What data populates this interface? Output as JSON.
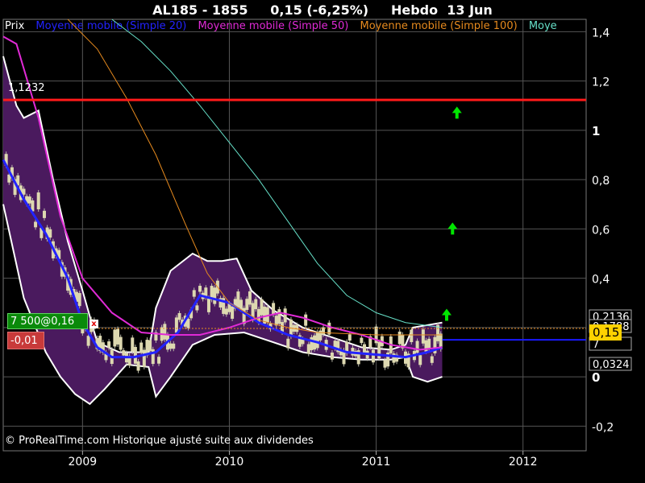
{
  "header": {
    "title": "AL185 - 1855     0,15 (-6,25%)     Hebdo  13 Jun"
  },
  "legend": [
    {
      "label": "Prix",
      "color": "#ffffff"
    },
    {
      "label": "Moyenne mobile (Simple 20)",
      "color": "#2323ff"
    },
    {
      "label": "Moyenne mobile (Simple 50)",
      "color": "#e02ad6"
    },
    {
      "label": "Moyenne mobile (Simple 100)",
      "color": "#e68a1e"
    },
    {
      "label": "Moye",
      "color": "#66e0c8"
    }
  ],
  "order": {
    "label": "7 500@0,16",
    "close_glyph": "x",
    "pnl": "-0,01"
  },
  "level_label": "1,1232",
  "copyright": "© ProRealTime.com Historique ajusté suite aux dividendes",
  "price_labels": {
    "hi": "0,2136",
    "last": "0,15",
    "mid": "0,1788",
    "low_partial": "7",
    "lo": "0,0324"
  },
  "colors": {
    "background": "#000000",
    "grid": "#555555",
    "band_fill": "#4a1a5e",
    "band_edge": "#ffffff",
    "sma20": "#2323ff",
    "sma50": "#e02ad6",
    "sma100": "#e68a1e",
    "sma200": "#66e0c8",
    "level": "#ff1a1a",
    "last_line": "#1a1aff",
    "arrow": "#00e600",
    "last_box": "#ffd200"
  },
  "chart_data": {
    "type": "line",
    "title": "AL185 - 1855     0,15 (-6,25%)     Hebdo  13 Jun",
    "xlabel": "",
    "ylabel": "",
    "x_ticks": [
      "2009",
      "2010",
      "2011",
      "2012"
    ],
    "x_tick_dates": [
      2009.0,
      2010.0,
      2011.0,
      2012.0
    ],
    "y_ticks": [
      "1,4",
      "1,2",
      "1",
      "0,8",
      "0,6",
      "0,4",
      "0,2",
      "0",
      "-0,2"
    ],
    "y_tick_values": [
      1.4,
      1.2,
      1.0,
      0.8,
      0.6,
      0.4,
      0.2,
      0.0,
      -0.2
    ],
    "ylim": [
      -0.3,
      1.45
    ],
    "xlim": [
      2008.46,
      2012.43
    ],
    "grid": true,
    "horizontal_level": 1.1232,
    "last_price": 0.15,
    "series": [
      {
        "name": "Moyenne mobile (Simple 20)",
        "x": [
          2008.46,
          2008.6,
          2008.75,
          2008.9,
          2009.0,
          2009.1,
          2009.2,
          2009.35,
          2009.5,
          2009.65,
          2009.8,
          2010.0,
          2010.2,
          2010.4,
          2010.6,
          2010.8,
          2011.0,
          2011.2,
          2011.35,
          2011.45
        ],
        "y": [
          0.88,
          0.72,
          0.58,
          0.4,
          0.22,
          0.12,
          0.08,
          0.08,
          0.1,
          0.18,
          0.33,
          0.3,
          0.22,
          0.17,
          0.14,
          0.1,
          0.09,
          0.08,
          0.1,
          0.12
        ]
      },
      {
        "name": "Moyenne mobile (Simple 50)",
        "x": [
          2008.46,
          2008.55,
          2008.7,
          2008.85,
          2009.0,
          2009.2,
          2009.4,
          2009.6,
          2009.8,
          2010.0,
          2010.2,
          2010.35,
          2010.5,
          2010.7,
          2010.9,
          2011.1,
          2011.3,
          2011.45
        ],
        "y": [
          1.38,
          1.35,
          1.05,
          0.65,
          0.4,
          0.26,
          0.18,
          0.17,
          0.17,
          0.2,
          0.24,
          0.26,
          0.24,
          0.2,
          0.17,
          0.13,
          0.11,
          0.12
        ]
      },
      {
        "name": "Moyenne mobile (Simple 100)",
        "x": [
          2008.9,
          2009.1,
          2009.3,
          2009.5,
          2009.7,
          2009.85,
          2010.0,
          2010.2,
          2010.4,
          2010.6,
          2010.8,
          2011.0,
          2011.2,
          2011.45
        ],
        "y": [
          1.45,
          1.33,
          1.13,
          0.9,
          0.62,
          0.42,
          0.3,
          0.23,
          0.2,
          0.18,
          0.175,
          0.17,
          0.17,
          0.17
        ]
      },
      {
        "name": "Moye",
        "x": [
          2009.2,
          2009.4,
          2009.6,
          2009.8,
          2010.0,
          2010.2,
          2010.4,
          2010.6,
          2010.8,
          2011.0,
          2011.2,
          2011.45
        ],
        "y": [
          1.45,
          1.36,
          1.24,
          1.1,
          0.95,
          0.8,
          0.63,
          0.46,
          0.33,
          0.26,
          0.22,
          0.2
        ]
      }
    ],
    "band_upper": {
      "x": [
        2008.46,
        2008.55,
        2008.6,
        2008.7,
        2008.8,
        2008.9,
        2009.0,
        2009.1,
        2009.25,
        2009.45,
        2009.5,
        2009.6,
        2009.75,
        2009.85,
        2009.95,
        2010.05,
        2010.15,
        2010.3,
        2010.5,
        2010.7,
        2010.9,
        2011.1,
        2011.2,
        2011.25,
        2011.35,
        2011.45
      ],
      "y": [
        1.3,
        1.1,
        1.05,
        1.08,
        0.8,
        0.55,
        0.35,
        0.14,
        0.1,
        0.1,
        0.28,
        0.43,
        0.5,
        0.47,
        0.47,
        0.48,
        0.35,
        0.27,
        0.2,
        0.16,
        0.12,
        0.11,
        0.13,
        0.2,
        0.21,
        0.22
      ]
    },
    "band_lower": {
      "x": [
        2008.46,
        2008.6,
        2008.75,
        2008.85,
        2008.95,
        2009.05,
        2009.15,
        2009.3,
        2009.45,
        2009.5,
        2009.6,
        2009.75,
        2009.9,
        2010.1,
        2010.3,
        2010.5,
        2010.7,
        2010.9,
        2011.1,
        2011.2,
        2011.25,
        2011.35,
        2011.45
      ],
      "y": [
        0.7,
        0.32,
        0.1,
        0.0,
        -0.07,
        -0.11,
        -0.05,
        0.05,
        0.04,
        -0.08,
        0.0,
        0.13,
        0.17,
        0.18,
        0.14,
        0.1,
        0.08,
        0.07,
        0.07,
        0.08,
        0.0,
        -0.02,
        0.0
      ]
    },
    "arrows": [
      {
        "x": 2011.55,
        "y": 1.07
      },
      {
        "x": 2011.52,
        "y": 0.6
      },
      {
        "x": 2011.48,
        "y": 0.25
      }
    ]
  }
}
